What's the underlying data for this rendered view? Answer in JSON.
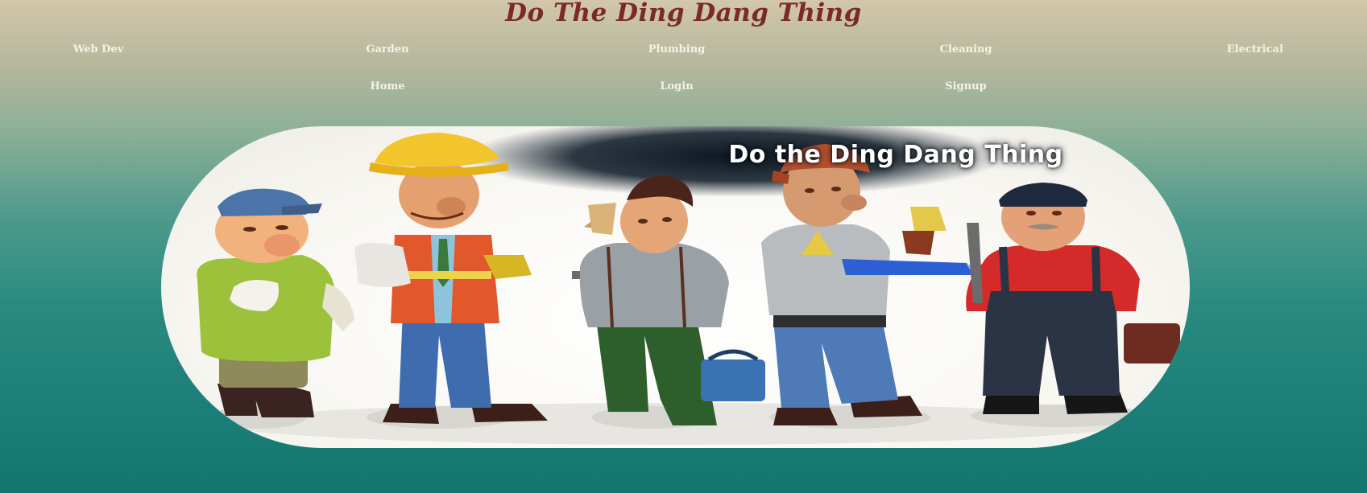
{
  "site": {
    "title": "Do The Ding Dang Thing"
  },
  "nav": {
    "primary": [
      {
        "label": "Web Dev"
      },
      {
        "label": "Garden"
      },
      {
        "label": "Plumbing"
      },
      {
        "label": "Cleaning"
      },
      {
        "label": "Electrical"
      }
    ],
    "secondary": [
      {
        "label": "Home"
      },
      {
        "label": "Login"
      },
      {
        "label": "Signup"
      }
    ]
  },
  "hero": {
    "caption": "Do the Ding Dang Thing",
    "figures": [
      "green-shirt-worker",
      "hard-hat-worker",
      "painter-worker",
      "electrician-worker",
      "plumber-worker"
    ]
  },
  "colors": {
    "title": "#7b2a2a",
    "nav_text": "#f6f2e6",
    "bg_top": "#d2c7aa",
    "bg_bottom": "#137570"
  }
}
